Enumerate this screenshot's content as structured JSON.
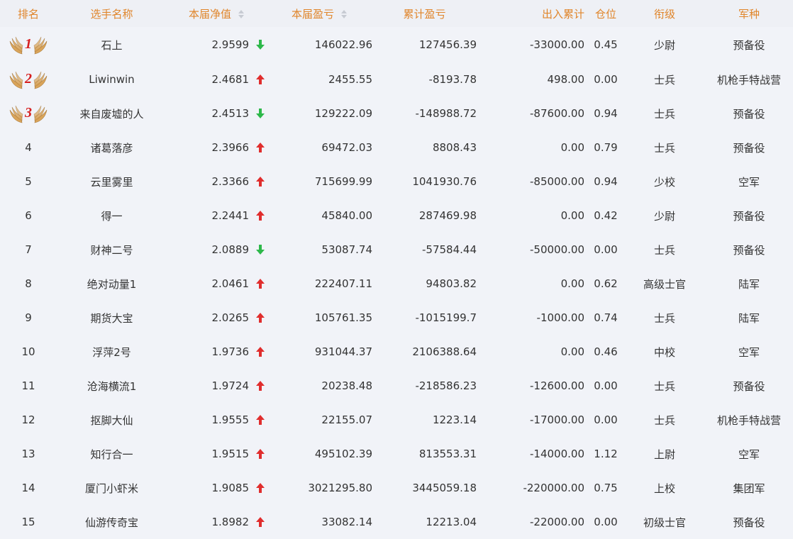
{
  "headers": {
    "rank": "排名",
    "name": "选手名称",
    "nav": "本届净值",
    "profit": "本届盈亏",
    "cum_profit": "累计盈亏",
    "inout": "出入累计",
    "position": "仓位",
    "title": "衔级",
    "branch": "军种"
  },
  "colors": {
    "header_text": "#e0852a",
    "up": "#e02d2d",
    "down": "#2db84a",
    "medal_gold": "#d9a45a",
    "medal_num": "#d61f1f"
  },
  "rows": [
    {
      "rank": "1",
      "medal": true,
      "name": "石上",
      "nav": "2.9599",
      "trend": "down",
      "profit": "146022.96",
      "cum_profit": "127456.39",
      "inout": "-33000.00",
      "position": "0.45",
      "title": "少尉",
      "branch": "预备役"
    },
    {
      "rank": "2",
      "medal": true,
      "name": "Liwinwin",
      "nav": "2.4681",
      "trend": "up",
      "profit": "2455.55",
      "cum_profit": "-8193.78",
      "inout": "498.00",
      "position": "0.00",
      "title": "士兵",
      "branch": "机枪手特战营"
    },
    {
      "rank": "3",
      "medal": true,
      "name": "来自废墟的人",
      "nav": "2.4513",
      "trend": "down",
      "profit": "129222.09",
      "cum_profit": "-148988.72",
      "inout": "-87600.00",
      "position": "0.94",
      "title": "士兵",
      "branch": "预备役"
    },
    {
      "rank": "4",
      "medal": false,
      "name": "诸葛落彦",
      "nav": "2.3966",
      "trend": "up",
      "profit": "69472.03",
      "cum_profit": "8808.43",
      "inout": "0.00",
      "position": "0.79",
      "title": "士兵",
      "branch": "预备役"
    },
    {
      "rank": "5",
      "medal": false,
      "name": "云里雾里",
      "nav": "2.3366",
      "trend": "up",
      "profit": "715699.99",
      "cum_profit": "1041930.76",
      "inout": "-85000.00",
      "position": "0.94",
      "title": "少校",
      "branch": "空军"
    },
    {
      "rank": "6",
      "medal": false,
      "name": "得一",
      "nav": "2.2441",
      "trend": "up",
      "profit": "45840.00",
      "cum_profit": "287469.98",
      "inout": "0.00",
      "position": "0.42",
      "title": "少尉",
      "branch": "预备役"
    },
    {
      "rank": "7",
      "medal": false,
      "name": "财神二号",
      "nav": "2.0889",
      "trend": "down",
      "profit": "53087.74",
      "cum_profit": "-57584.44",
      "inout": "-50000.00",
      "position": "0.00",
      "title": "士兵",
      "branch": "预备役"
    },
    {
      "rank": "8",
      "medal": false,
      "name": "绝对动量1",
      "nav": "2.0461",
      "trend": "up",
      "profit": "222407.11",
      "cum_profit": "94803.82",
      "inout": "0.00",
      "position": "0.62",
      "title": "高级士官",
      "branch": "陆军"
    },
    {
      "rank": "9",
      "medal": false,
      "name": "期货大宝",
      "nav": "2.0265",
      "trend": "up",
      "profit": "105761.35",
      "cum_profit": "-1015199.7",
      "inout": "-1000.00",
      "position": "0.74",
      "title": "士兵",
      "branch": "陆军"
    },
    {
      "rank": "10",
      "medal": false,
      "name": "浮萍2号",
      "nav": "1.9736",
      "trend": "up",
      "profit": "931044.37",
      "cum_profit": "2106388.64",
      "inout": "0.00",
      "position": "0.46",
      "title": "中校",
      "branch": "空军"
    },
    {
      "rank": "11",
      "medal": false,
      "name": "沧海横流1",
      "nav": "1.9724",
      "trend": "up",
      "profit": "20238.48",
      "cum_profit": "-218586.23",
      "inout": "-12600.00",
      "position": "0.00",
      "title": "士兵",
      "branch": "预备役"
    },
    {
      "rank": "12",
      "medal": false,
      "name": "抠脚大仙",
      "nav": "1.9555",
      "trend": "up",
      "profit": "22155.07",
      "cum_profit": "1223.14",
      "inout": "-17000.00",
      "position": "0.00",
      "title": "士兵",
      "branch": "机枪手特战营"
    },
    {
      "rank": "13",
      "medal": false,
      "name": "知行合一",
      "nav": "1.9515",
      "trend": "up",
      "profit": "495102.39",
      "cum_profit": "813553.31",
      "inout": "-14000.00",
      "position": "1.12",
      "title": "上尉",
      "branch": "空军"
    },
    {
      "rank": "14",
      "medal": false,
      "name": "厦门小虾米",
      "nav": "1.9085",
      "trend": "up",
      "profit": "3021295.80",
      "cum_profit": "3445059.18",
      "inout": "-220000.00",
      "position": "0.75",
      "title": "上校",
      "branch": "集团军"
    },
    {
      "rank": "15",
      "medal": false,
      "name": "仙游传奇宝",
      "nav": "1.8982",
      "trend": "up",
      "profit": "33082.14",
      "cum_profit": "12213.04",
      "inout": "-22000.00",
      "position": "0.00",
      "title": "初级士官",
      "branch": "预备役"
    }
  ]
}
